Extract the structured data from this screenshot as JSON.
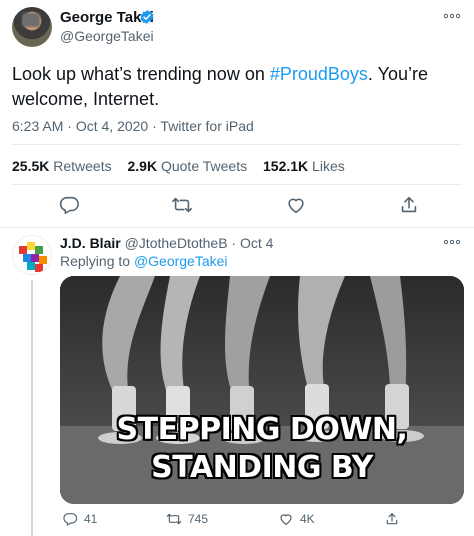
{
  "main_tweet": {
    "author_name": "George Takei",
    "author_handle": "@GeorgeTakei",
    "text_before": "Look up what’s trending now on ",
    "hashtag": "#ProudBoys",
    "text_after": ". You’re welcome, Internet.",
    "time": "6:23 AM",
    "date": "Oct 4, 2020",
    "client": "Twitter for iPad",
    "stats": {
      "retweets_count": "25.5K",
      "retweets_label": "Retweets",
      "quote_count": "2.9K",
      "quote_label": "Quote Tweets",
      "likes_count": "152.1K",
      "likes_label": "Likes"
    },
    "actions": [
      "reply-icon",
      "retweet-icon",
      "like-icon",
      "share-icon"
    ]
  },
  "reply": {
    "author_name": "J.D. Blair",
    "author_handle": "@JtotheDtotheB",
    "separator": "·",
    "date": "Oct 4",
    "replying_prefix": "Replying to ",
    "replying_handle": "@GeorgeTakei",
    "media_caption_line1": "STEPPING DOWN,",
    "media_caption_line2": "STANDING BY",
    "counts": {
      "replies": "41",
      "retweets": "745",
      "likes": "4K"
    }
  },
  "colors": {
    "accent": "#1d9bf0",
    "secondary_text": "#536471",
    "border": "#e6ecf0"
  }
}
